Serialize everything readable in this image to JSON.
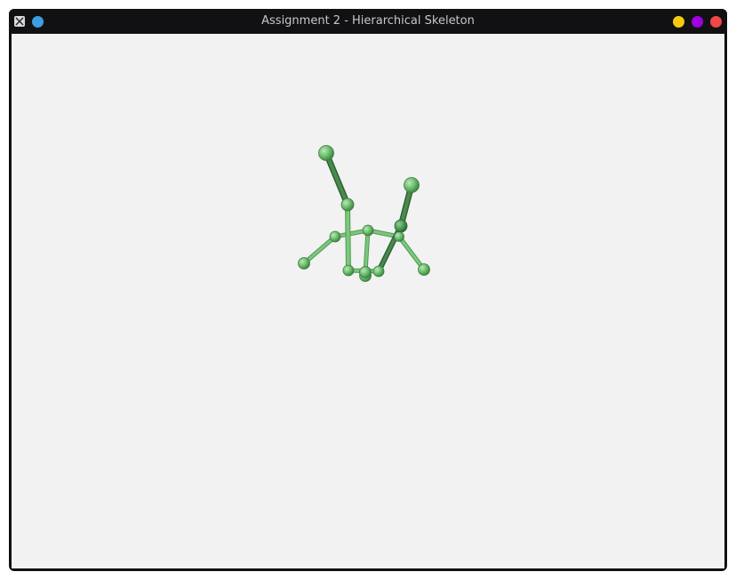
{
  "window": {
    "title": "Assignment 2 - Hierarchical Skeleton",
    "app_icon": "x11-icon",
    "buttons": {
      "menu": {
        "icon": "blue-dot-icon",
        "color": "#3d9ee0"
      },
      "minimize": {
        "icon": "yellow-dot-icon",
        "color": "#f6c90e"
      },
      "maximize": {
        "icon": "purple-dot-icon",
        "color": "#a000e0"
      },
      "close": {
        "icon": "red-dot-icon",
        "color": "#f04848"
      }
    }
  },
  "scene": {
    "background_color": "#f2f2f2",
    "bone_color_light": "#7cc77c",
    "bone_color_dark": "#3f7a44",
    "description_icon": "skeleton-model"
  }
}
